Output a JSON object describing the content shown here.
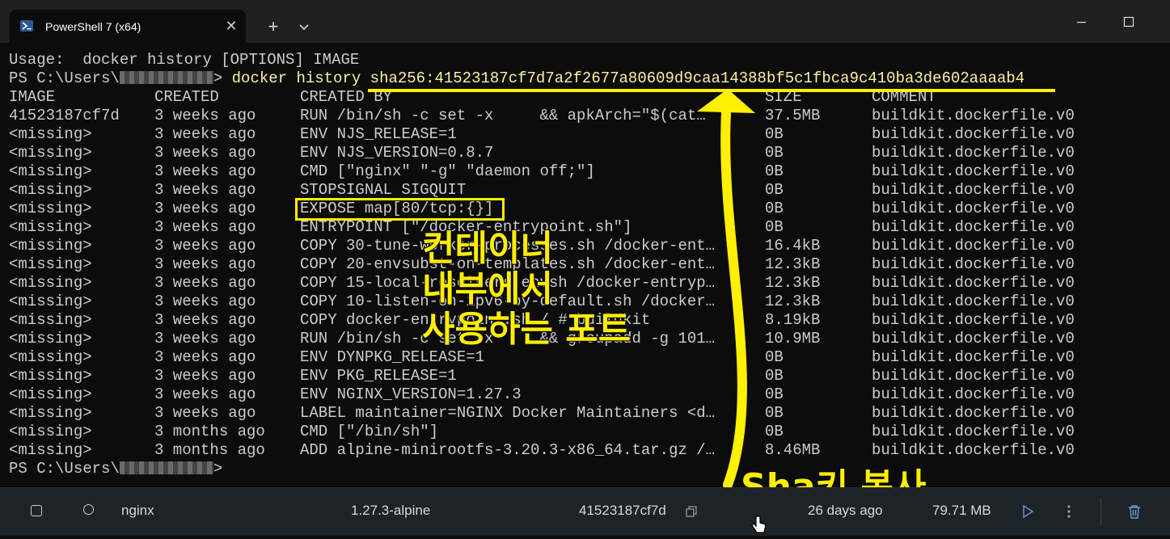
{
  "window": {
    "tab_title": "PowerShell 7 (x64)",
    "tab_close": "✕",
    "new_tab": "+"
  },
  "terminal": {
    "usage_line": "Usage:  docker history [OPTIONS] IMAGE",
    "prompt_prefix": "PS C:\\Users\\",
    "prompt_suffix": "> ",
    "command": "docker history sha256:41523187cf7d7a2f2677a80609d9caa14388bf5c1fbca9c410ba3de602aaaab4",
    "headers": [
      "IMAGE",
      "CREATED",
      "CREATED BY",
      "SIZE",
      "COMMENT"
    ],
    "rows": [
      [
        "41523187cf7d",
        "3 weeks ago",
        "RUN /bin/sh -c set -x     && apkArch=\"$(cat…",
        "37.5MB",
        "buildkit.dockerfile.v0"
      ],
      [
        "<missing>",
        "3 weeks ago",
        "ENV NJS_RELEASE=1",
        "0B",
        "buildkit.dockerfile.v0"
      ],
      [
        "<missing>",
        "3 weeks ago",
        "ENV NJS_VERSION=0.8.7",
        "0B",
        "buildkit.dockerfile.v0"
      ],
      [
        "<missing>",
        "3 weeks ago",
        "CMD [\"nginx\" \"-g\" \"daemon off;\"]",
        "0B",
        "buildkit.dockerfile.v0"
      ],
      [
        "<missing>",
        "3 weeks ago",
        "STOPSIGNAL SIGQUIT",
        "0B",
        "buildkit.dockerfile.v0"
      ],
      [
        "<missing>",
        "3 weeks ago",
        "EXPOSE map[80/tcp:{}]",
        "0B",
        "buildkit.dockerfile.v0"
      ],
      [
        "<missing>",
        "3 weeks ago",
        "ENTRYPOINT [\"/docker-entrypoint.sh\"]",
        "0B",
        "buildkit.dockerfile.v0"
      ],
      [
        "<missing>",
        "3 weeks ago",
        "COPY 30-tune-worker-processes.sh /docker-ent…",
        "16.4kB",
        "buildkit.dockerfile.v0"
      ],
      [
        "<missing>",
        "3 weeks ago",
        "COPY 20-envsubst-on-templates.sh /docker-ent…",
        "12.3kB",
        "buildkit.dockerfile.v0"
      ],
      [
        "<missing>",
        "3 weeks ago",
        "COPY 15-local-resolvers.envsh /docker-entryp…",
        "12.3kB",
        "buildkit.dockerfile.v0"
      ],
      [
        "<missing>",
        "3 weeks ago",
        "COPY 10-listen-on-ipv6-by-default.sh /docker…",
        "12.3kB",
        "buildkit.dockerfile.v0"
      ],
      [
        "<missing>",
        "3 weeks ago",
        "COPY docker-entrypoint.sh / # buildkit",
        "8.19kB",
        "buildkit.dockerfile.v0"
      ],
      [
        "<missing>",
        "3 weeks ago",
        "RUN /bin/sh -c set -x     && groupadd -g 101…",
        "10.9MB",
        "buildkit.dockerfile.v0"
      ],
      [
        "<missing>",
        "3 weeks ago",
        "ENV DYNPKG_RELEASE=1",
        "0B",
        "buildkit.dockerfile.v0"
      ],
      [
        "<missing>",
        "3 weeks ago",
        "ENV PKG_RELEASE=1",
        "0B",
        "buildkit.dockerfile.v0"
      ],
      [
        "<missing>",
        "3 weeks ago",
        "ENV NGINX_VERSION=1.27.3",
        "0B",
        "buildkit.dockerfile.v0"
      ],
      [
        "<missing>",
        "3 weeks ago",
        "LABEL maintainer=NGINX Docker Maintainers <d…",
        "0B",
        "buildkit.dockerfile.v0"
      ],
      [
        "<missing>",
        "3 months ago",
        "CMD [\"/bin/sh\"]",
        "0B",
        "buildkit.dockerfile.v0"
      ],
      [
        "<missing>",
        "3 months ago",
        "ADD alpine-minirootfs-3.20.3-x86_64.tar.gz /…",
        "8.46MB",
        "buildkit.dockerfile.v0"
      ]
    ]
  },
  "annotations": {
    "port_note_line1": "컨테이너",
    "port_note_line2": "내부에서",
    "port_note_line3": "사용하는 포트",
    "sha_note": "Sha키 복사"
  },
  "docker_image_row": {
    "name": "nginx",
    "tag": "1.27.3-alpine",
    "image_id": "41523187cf7d",
    "created": "26 days ago",
    "size": "79.71 MB"
  },
  "colors": {
    "highlight": "#ffef00",
    "terminal_bg": "#0c0c0c",
    "prompt_command": "#f9f1a5"
  }
}
